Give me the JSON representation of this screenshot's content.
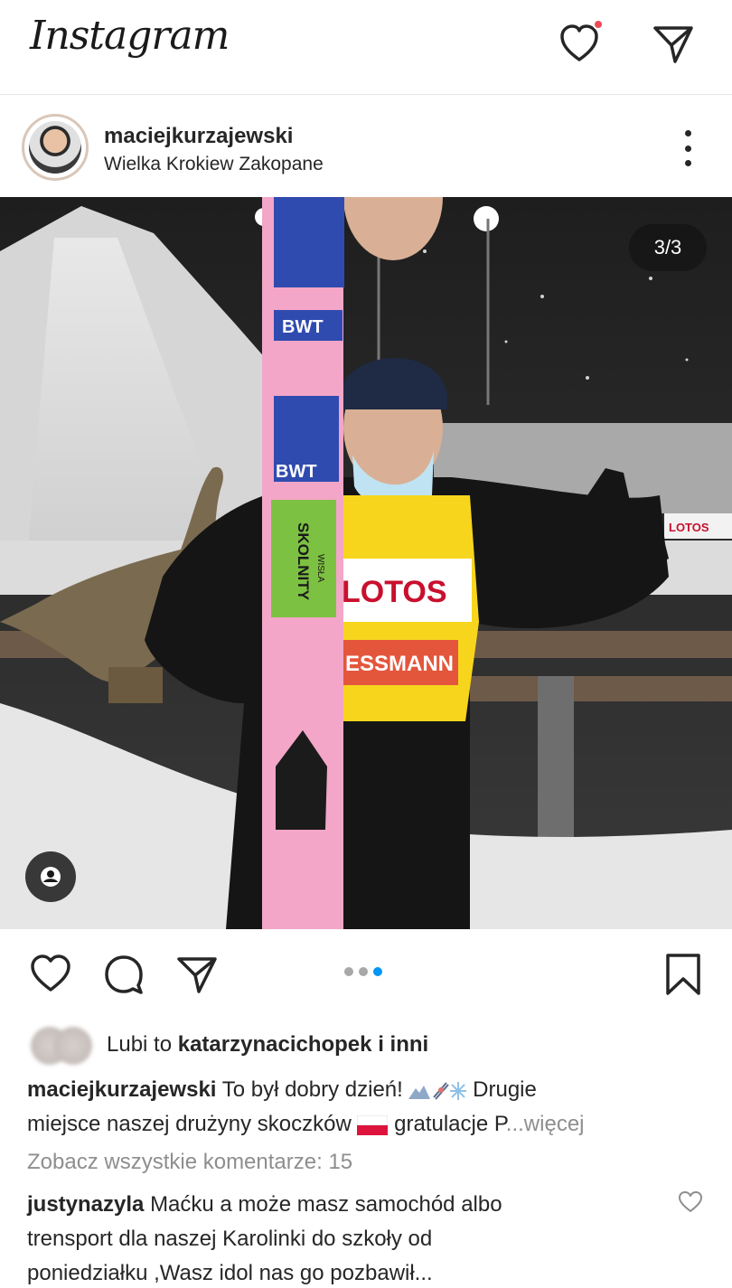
{
  "app": {
    "name": "Instagram"
  },
  "header": {
    "icons": [
      "heart-icon",
      "direct-message-icon"
    ],
    "accent_dot_color": "#ed4956"
  },
  "post": {
    "username": "maciejkurzajewski",
    "location": "Wielka Krokiew Zakopane",
    "carousel_counter": "3/3",
    "carousel": {
      "count": 3,
      "active_index": 2,
      "active_color": "#0095f6"
    },
    "likes": {
      "prefix": "Lubi to",
      "user": "katarzynacichopek",
      "suffix": "i inni"
    },
    "caption": {
      "username": "maciejkurzajewski",
      "text_line1": "To był dobry dzień!",
      "text_after_emoji": "Drugie",
      "text_line2": "miejsce naszej drużyny skoczków",
      "text_after_flag": "gratulacje P",
      "more": "...więcej"
    },
    "view_all_comments": "Zobacz wszystkie komentarze: 15",
    "comment": {
      "username": "justynazyla",
      "text_line1": "Maćku a może masz samochód albo",
      "text_line2": "trensport dla naszej Karolinki do szkoły od",
      "text_line3": "poniedziałku ,Wasz idol nas go pozbawił..."
    },
    "photo_text": {
      "ski_brand_1": "BWT",
      "ski_brand_2": "BWT",
      "ski_sticker": "SKOLNITY",
      "ski_sticker_small": "WISŁA",
      "bib_sponsor": "LOTOS",
      "bib_sponsor_2": "ESSMANN",
      "banner": "LOTOS"
    }
  }
}
